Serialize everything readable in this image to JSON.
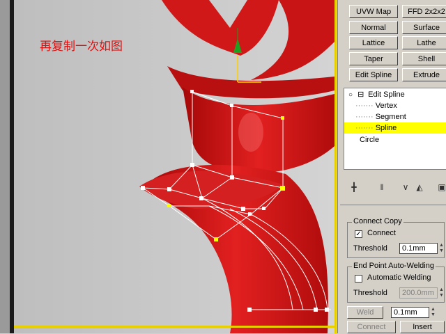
{
  "viewport": {
    "caption": "再复制一次如图"
  },
  "modifier_buttons": [
    {
      "label": "UVW Map"
    },
    {
      "label": "FFD 2x2x2"
    },
    {
      "label": "Normal"
    },
    {
      "label": "Surface"
    },
    {
      "label": "Lattice"
    },
    {
      "label": "Lathe"
    },
    {
      "label": "Taper"
    },
    {
      "label": "Shell"
    },
    {
      "label": "Edit Spline"
    },
    {
      "label": "Extrude"
    }
  ],
  "stack": {
    "items": [
      {
        "label": "Edit Spline",
        "type": "modifier",
        "expanded": true
      },
      {
        "label": "Vertex",
        "type": "sub-object"
      },
      {
        "label": "Segment",
        "type": "sub-object"
      },
      {
        "label": "Spline",
        "type": "sub-object",
        "selected": true
      },
      {
        "label": "Circle",
        "type": "base-object"
      }
    ],
    "expand_symbol": "⊟"
  },
  "connect_copy": {
    "title": "Connect Copy",
    "connect_label": "Connect",
    "connect_checked": true,
    "threshold_label": "Threshold",
    "threshold_value": "0.1mm"
  },
  "end_point_welding": {
    "title": "End Point Auto-Welding",
    "auto_weld_label": "Automatic Welding",
    "auto_weld_checked": false,
    "threshold_label": "Threshold",
    "threshold_value": "200.0mm"
  },
  "weld": {
    "weld_label": "Weld",
    "weld_value": "0.1mm",
    "connect_label": "Connect",
    "insert_label": "Insert"
  },
  "colors": {
    "selection_highlight": "#ffff00",
    "object_red": "#d81a1a",
    "caption_red": "#e01010",
    "viewport_border": "#e8d000"
  }
}
